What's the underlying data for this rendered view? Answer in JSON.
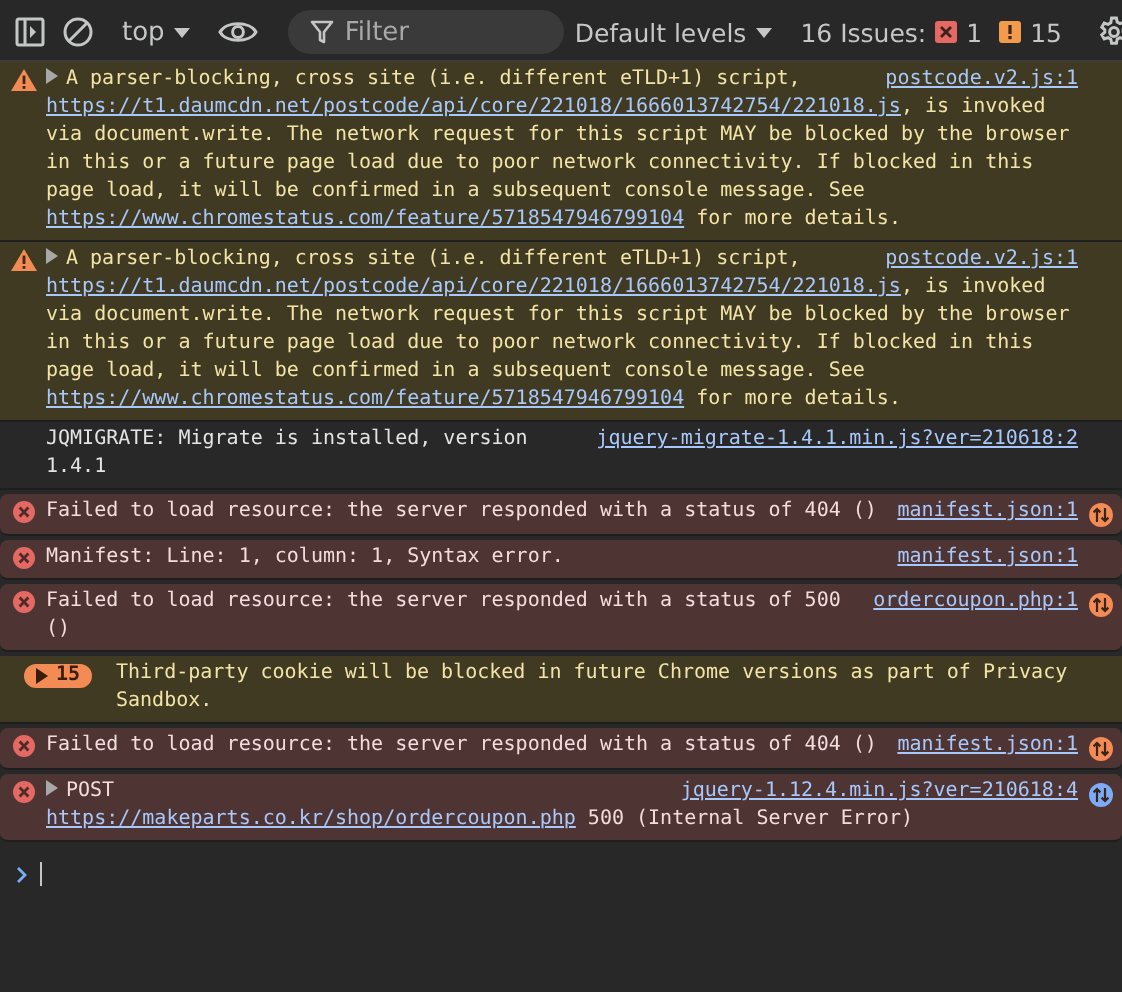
{
  "toolbar": {
    "context": "top",
    "filter": {
      "placeholder": "Filter"
    },
    "levels": "Default levels",
    "issues": {
      "label": "16 Issues:",
      "counts": [
        {
          "kind": "error",
          "count": "1"
        },
        {
          "kind": "warning",
          "count": "15"
        }
      ]
    }
  },
  "messages": [
    {
      "kind": "warning",
      "expandable": true,
      "source": "postcode.v2.js:1",
      "network": false,
      "parts": [
        {
          "text": "A parser-blocking, cross site (i.e. different eTLD+1) script, ",
          "link": false
        },
        {
          "text": "https://t1.daumcdn.net/postcode/api/core/221018/1666013742754/221018.js",
          "link": true
        },
        {
          "text": ", is invoked via document.write. The network request for this script MAY be blocked by the browser in this or a future page load due to poor network connectivity. If blocked in this page load, it will be confirmed in a subsequent console message. See ",
          "link": false
        },
        {
          "text": "https://www.chromestatus.com/feature/5718547946799104",
          "link": true
        },
        {
          "text": " for more details.",
          "link": false
        }
      ]
    },
    {
      "kind": "warning",
      "expandable": true,
      "source": "postcode.v2.js:1",
      "network": false,
      "parts": [
        {
          "text": "A parser-blocking, cross site (i.e. different eTLD+1) script, ",
          "link": false
        },
        {
          "text": "https://t1.daumcdn.net/postcode/api/core/221018/1666013742754/221018.js",
          "link": true
        },
        {
          "text": ", is invoked via document.write. The network request for this script MAY be blocked by the browser in this or a future page load due to poor network connectivity. If blocked in this page load, it will be confirmed in a subsequent console message. See ",
          "link": false
        },
        {
          "text": "https://www.chromestatus.com/feature/5718547946799104",
          "link": true
        },
        {
          "text": " for more details.",
          "link": false
        }
      ]
    },
    {
      "kind": "info",
      "expandable": false,
      "source": "jquery-migrate-1.4.1.min.js?ver=210618:2",
      "network": false,
      "parts": [
        {
          "text": "JQMIGRATE: Migrate is installed, version 1.4.1",
          "link": false
        }
      ]
    },
    {
      "kind": "error",
      "expandable": false,
      "source": "manifest.json:1",
      "network": true,
      "color": "#f28b54",
      "parts": [
        {
          "text": "Failed to load resource: the server responded with a status of 404 ()",
          "link": false
        }
      ]
    },
    {
      "kind": "error",
      "expandable": false,
      "source": "manifest.json:1",
      "network": false,
      "parts": [
        {
          "text": "Manifest: Line: 1, column: 1, Syntax error.",
          "link": false
        }
      ]
    },
    {
      "kind": "error",
      "expandable": false,
      "source": "ordercoupon.php:1",
      "network": true,
      "color": "#f28b54",
      "parts": [
        {
          "text": "Failed to load resource: the server responded with a status of 500 ()",
          "link": false
        }
      ]
    },
    {
      "kind": "issue",
      "badge": "15",
      "expandable": false,
      "network": false,
      "parts": [
        {
          "text": "Third-party cookie will be blocked in future Chrome versions as part of Privacy Sandbox.",
          "link": false
        }
      ]
    },
    {
      "kind": "error",
      "expandable": false,
      "source": "manifest.json:1",
      "network": true,
      "color": "#f28b54",
      "parts": [
        {
          "text": "Failed to load resource: the server responded with a status of 404 ()",
          "link": false
        }
      ]
    },
    {
      "kind": "error",
      "expandable": true,
      "source": "jquery-1.12.4.min.js?ver=210618:4",
      "network": true,
      "color": "#7cacf8",
      "parts": [
        {
          "text": "POST ",
          "link": false
        },
        {
          "text": "https://makeparts.co.kr/shop/ordercoupon.php",
          "link": true
        },
        {
          "text": " 500 (Internal Server Error)",
          "link": false
        }
      ]
    }
  ]
}
